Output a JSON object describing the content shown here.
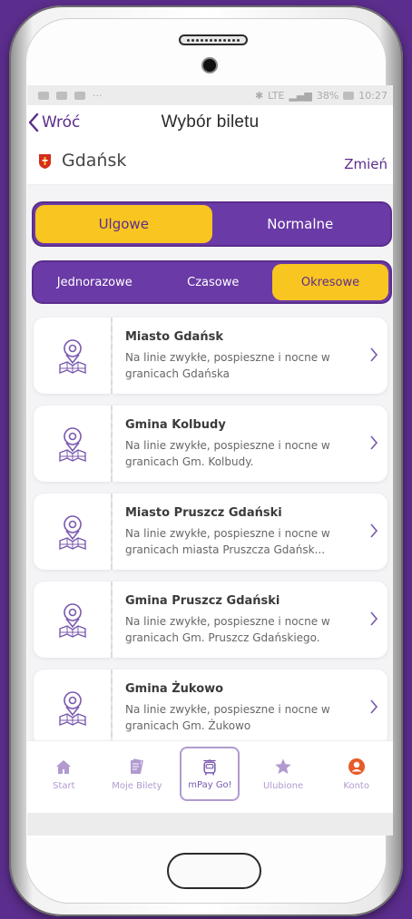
{
  "status_bar": {
    "battery": "38%",
    "time": "10:27",
    "network": "LTE"
  },
  "header": {
    "back_label": "Wróć",
    "title": "Wybór biletu"
  },
  "city": {
    "name": "Gdańsk",
    "change_label": "Zmień"
  },
  "discount_tabs": [
    {
      "label": "Ulgowe",
      "active": true
    },
    {
      "label": "Normalne",
      "active": false
    }
  ],
  "period_tabs": [
    {
      "label": "Jednorazowe",
      "active": false
    },
    {
      "label": "Czasowe",
      "active": false
    },
    {
      "label": "Okresowe",
      "active": true
    }
  ],
  "tickets": [
    {
      "name": "Miasto Gdańsk",
      "description": "Na linie zwykłe, pospieszne i nocne w granicach Gdańska",
      "icon": "map-pin-icon"
    },
    {
      "name": "Gmina Kolbudy",
      "description": "Na linie zwykłe, pospieszne i nocne w granicach Gm. Kolbudy.",
      "icon": "map-pin-icon"
    },
    {
      "name": "Miasto Pruszcz Gdański",
      "description": "Na linie zwykłe, pospieszne i nocne w granicach miasta Pruszcza Gdańsk...",
      "icon": "map-pin-icon"
    },
    {
      "name": "Gmina Pruszcz Gdański",
      "description": "Na linie zwykłe, pospieszne i nocne w granicach Gm. Pruszcz Gdańskiego.",
      "icon": "map-pin-icon"
    },
    {
      "name": "Gmina Żukowo",
      "description": "Na linie zwykłe, pospieszne i nocne w granicach Gm. Żukowo",
      "icon": "map-pin-icon"
    }
  ],
  "tabbar": [
    {
      "label": "Start",
      "icon": "home-icon"
    },
    {
      "label": "Moje Bilety",
      "icon": "tickets-icon"
    },
    {
      "label": "mPay Go!",
      "icon": "bus-icon"
    },
    {
      "label": "Ulubione",
      "icon": "star-icon"
    },
    {
      "label": "Konto",
      "icon": "account-icon"
    }
  ],
  "colors": {
    "brand": "#5b2d8c",
    "accent": "#f9c520",
    "tab_inactive": "#b19ad0"
  }
}
